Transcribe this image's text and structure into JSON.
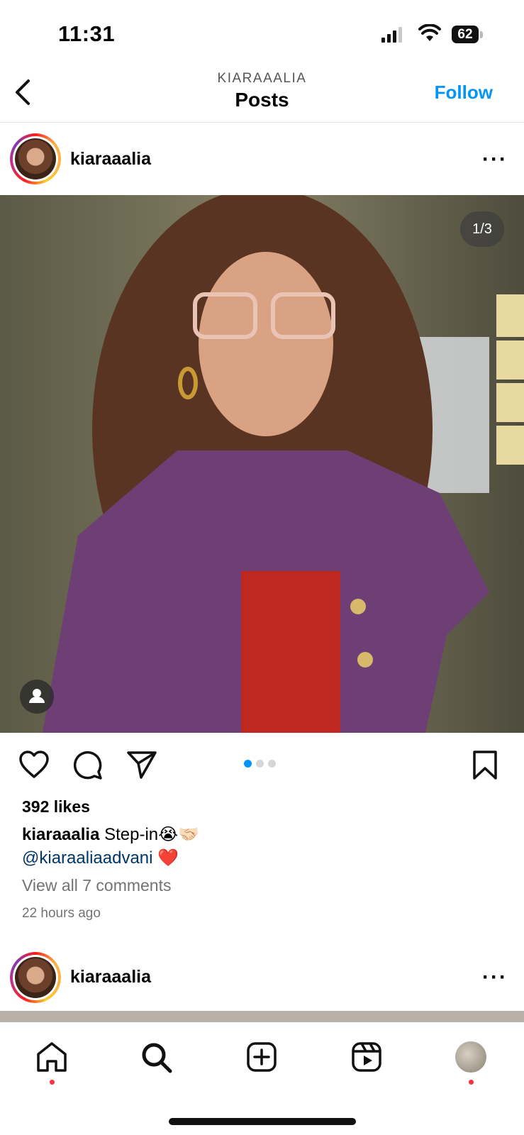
{
  "status_bar": {
    "time": "11:31",
    "battery": "62"
  },
  "header": {
    "subtitle": "KIARAAALIA",
    "title": "Posts",
    "follow_label": "Follow"
  },
  "post": {
    "username": "kiaraaalia",
    "image_counter": "1/3",
    "carousel": {
      "total": 3,
      "active_index": 0
    },
    "likes": "392 likes",
    "caption_user": "kiaraaalia",
    "caption_text": "Step-in😭🤝🏻",
    "caption_mention": "@kiaraaliaadvani",
    "caption_emoji": "❤️",
    "view_comments": "View all 7 comments",
    "time_ago": "22 hours ago"
  },
  "next_post": {
    "username": "kiaraaalia"
  },
  "icons": {
    "back": "chevron-left-icon",
    "more": "more-horizontal-icon",
    "like": "heart-icon",
    "comment": "comment-icon",
    "share": "send-icon",
    "save": "bookmark-icon",
    "tag": "person-icon",
    "tabs": [
      "home-icon",
      "search-icon",
      "create-icon",
      "reels-icon",
      "profile-avatar"
    ]
  },
  "colors": {
    "accent": "#0095f6",
    "mention": "#00376b",
    "notification": "#ff3040",
    "muted": "#737373"
  }
}
